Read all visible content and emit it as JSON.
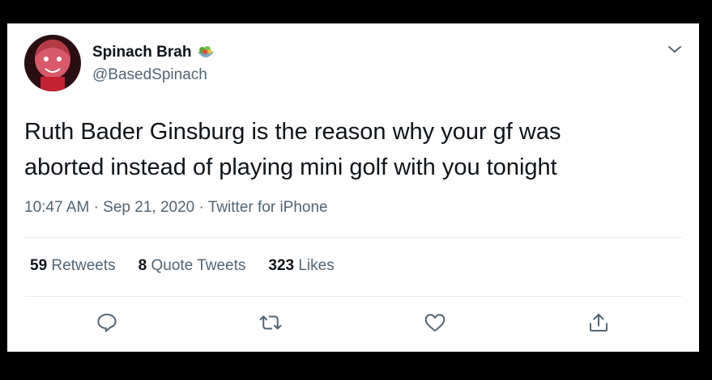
{
  "user": {
    "display_name": "Spinach Brah",
    "handle": "@BasedSpinach",
    "badge_icon": "salad-emoji-icon"
  },
  "tweet": {
    "text_line1": "Ruth Bader Ginsburg is the reason why your gf was",
    "text_line2": "aborted instead of playing mini golf with you tonight",
    "time": "10:47 AM",
    "date": "Sep 21, 2020",
    "source": "Twitter for iPhone",
    "sep": "·"
  },
  "stats": {
    "retweets_count": "59",
    "retweets_label": "Retweets",
    "quotes_count": "8",
    "quotes_label": "Quote Tweets",
    "likes_count": "323",
    "likes_label": "Likes"
  },
  "actions": {
    "reply_icon": "reply-icon",
    "retweet_icon": "retweet-icon",
    "like_icon": "heart-icon",
    "share_icon": "share-icon"
  },
  "colors": {
    "text": "#0f1419",
    "secondary": "#536471",
    "divider": "#e6ecf0",
    "background": "#000000"
  }
}
